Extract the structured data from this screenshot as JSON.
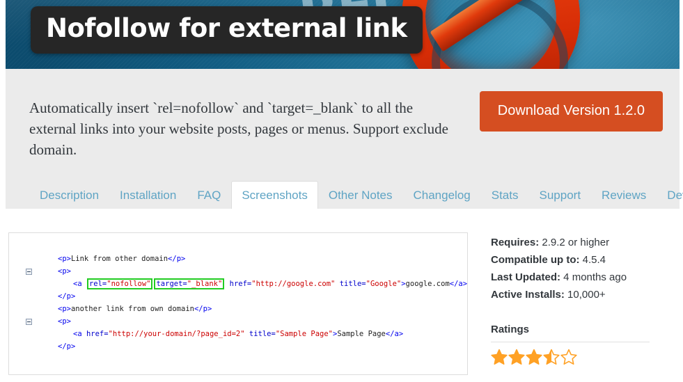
{
  "banner": {
    "title": "Nofollow for external link",
    "ghost_word": "REL",
    "icon": "prohibition-sign-icon"
  },
  "intro": {
    "description": "Automatically insert `rel=nofollow` and `target=_blank` to all the external links into your website posts, pages or menus. Support exclude domain.",
    "download_label": "Download Version 1.2.0",
    "download_color": "#d54e21"
  },
  "tabs": {
    "active": "Screenshots",
    "items": [
      {
        "label": "Description",
        "active": false
      },
      {
        "label": "Installation",
        "active": false
      },
      {
        "label": "FAQ",
        "active": false
      },
      {
        "label": "Screenshots",
        "active": true
      },
      {
        "label": "Other Notes",
        "active": false
      },
      {
        "label": "Changelog",
        "active": false
      },
      {
        "label": "Stats",
        "active": false
      },
      {
        "label": "Support",
        "active": false
      },
      {
        "label": "Reviews",
        "active": false
      },
      {
        "label": "Developers",
        "active": false
      }
    ]
  },
  "screenshot": {
    "code_lines": [
      {
        "toggle": false,
        "indent": 1,
        "tokens": [
          {
            "t": "tag",
            "s": "<p>"
          },
          {
            "t": "text",
            "s": "Link from other domain"
          },
          {
            "t": "tag",
            "s": "</p>"
          }
        ]
      },
      {
        "toggle": true,
        "indent": 1,
        "tokens": [
          {
            "t": "tag",
            "s": "<p>"
          }
        ]
      },
      {
        "toggle": false,
        "indent": 2,
        "tokens": [
          {
            "t": "tag",
            "s": "<a "
          },
          {
            "t": "box-attr",
            "s": "rel=",
            "v": "\"nofollow\""
          },
          {
            "t": "box-attr",
            "s": "target=",
            "v": "\"_blank\""
          },
          {
            "t": "attr",
            "s": " href="
          },
          {
            "t": "val",
            "s": "\"http://google.com\""
          },
          {
            "t": "attr",
            "s": " title="
          },
          {
            "t": "val",
            "s": "\"Google\""
          },
          {
            "t": "tag",
            "s": ">"
          },
          {
            "t": "text",
            "s": "google.com"
          },
          {
            "t": "tag",
            "s": "</a>"
          }
        ]
      },
      {
        "toggle": false,
        "indent": 1,
        "tokens": [
          {
            "t": "tag",
            "s": "</p>"
          }
        ]
      },
      {
        "toggle": false,
        "indent": 1,
        "tokens": [
          {
            "t": "tag",
            "s": "<p>"
          },
          {
            "t": "text",
            "s": "another link from own domain"
          },
          {
            "t": "tag",
            "s": "</p>"
          }
        ]
      },
      {
        "toggle": true,
        "indent": 1,
        "tokens": [
          {
            "t": "tag",
            "s": "<p>"
          }
        ]
      },
      {
        "toggle": false,
        "indent": 2,
        "tokens": [
          {
            "t": "tag",
            "s": "<a "
          },
          {
            "t": "attr",
            "s": "href="
          },
          {
            "t": "val",
            "s": "\"http://your-domain/?page_id=2\""
          },
          {
            "t": "attr",
            "s": " title="
          },
          {
            "t": "val",
            "s": "\"Sample Page\""
          },
          {
            "t": "tag",
            "s": ">"
          },
          {
            "t": "text",
            "s": "Sample Page"
          },
          {
            "t": "tag",
            "s": "</a>"
          }
        ]
      },
      {
        "toggle": false,
        "indent": 1,
        "tokens": [
          {
            "t": "tag",
            "s": "</p>"
          }
        ]
      }
    ]
  },
  "sidebar": {
    "meta": [
      {
        "label": "Requires:",
        "value": " 2.9.2 or higher"
      },
      {
        "label": "Compatible up to:",
        "value": " 4.5.4"
      },
      {
        "label": "Last Updated:",
        "value": " 4 months ago"
      },
      {
        "label": "Active Installs:",
        "value": " 10,000+"
      }
    ],
    "ratings_heading": "Ratings",
    "rating_value": 3.5,
    "rating_max": 5,
    "star_color": "#ffa125"
  }
}
